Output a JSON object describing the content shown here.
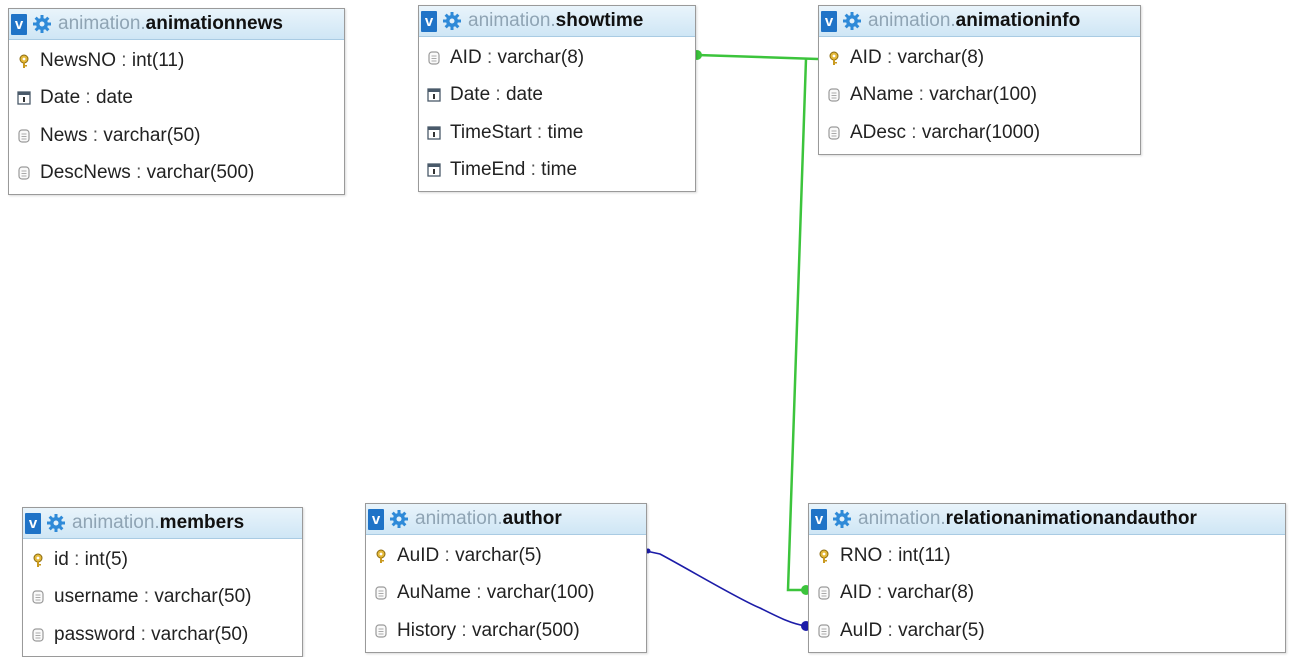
{
  "tables": [
    {
      "db": "animation.",
      "name": "animationnews",
      "columns": [
        {
          "name": "NewsNO",
          "type": "int(11)",
          "icon": "primary-key-icon"
        },
        {
          "name": "Date",
          "type": "date",
          "icon": "date-icon"
        },
        {
          "name": "News",
          "type": "varchar(50)",
          "icon": "text-column-icon"
        },
        {
          "name": "DescNews",
          "type": "varchar(500)",
          "icon": "text-column-icon"
        }
      ]
    },
    {
      "db": "animation.",
      "name": "showtime",
      "columns": [
        {
          "name": "AID",
          "type": "varchar(8)",
          "icon": "text-column-icon"
        },
        {
          "name": "Date",
          "type": "date",
          "icon": "date-icon"
        },
        {
          "name": "TimeStart",
          "type": "time",
          "icon": "date-icon"
        },
        {
          "name": "TimeEnd",
          "type": "time",
          "icon": "date-icon"
        }
      ]
    },
    {
      "db": "animation.",
      "name": "animationinfo",
      "columns": [
        {
          "name": "AID",
          "type": "varchar(8)",
          "icon": "primary-key-icon"
        },
        {
          "name": "AName",
          "type": "varchar(100)",
          "icon": "text-column-icon"
        },
        {
          "name": "ADesc",
          "type": "varchar(1000)",
          "icon": "text-column-icon"
        }
      ]
    },
    {
      "db": "animation.",
      "name": "members",
      "columns": [
        {
          "name": "id",
          "type": "int(5)",
          "icon": "primary-key-icon"
        },
        {
          "name": "username",
          "type": "varchar(50)",
          "icon": "text-column-icon"
        },
        {
          "name": "password",
          "type": "varchar(50)",
          "icon": "text-column-icon"
        }
      ]
    },
    {
      "db": "animation.",
      "name": "author",
      "columns": [
        {
          "name": "AuID",
          "type": "varchar(5)",
          "icon": "primary-key-icon"
        },
        {
          "name": "AuName",
          "type": "varchar(100)",
          "icon": "text-column-icon"
        },
        {
          "name": "History",
          "type": "varchar(500)",
          "icon": "text-column-icon"
        }
      ]
    },
    {
      "db": "animation.",
      "name": "relationanimationandauthor",
      "columns": [
        {
          "name": "RNO",
          "type": "int(11)",
          "icon": "primary-key-icon"
        },
        {
          "name": "AID",
          "type": "varchar(8)",
          "icon": "text-column-icon"
        },
        {
          "name": "AuID",
          "type": "varchar(5)",
          "icon": "text-column-icon"
        }
      ]
    }
  ],
  "ui": {
    "collapse_label": "v",
    "separator": " : "
  },
  "colors": {
    "relation_green": "#3cc43c",
    "relation_blue": "#1c1ca8",
    "toggle_blue": "#1f73c7",
    "gear_blue": "#2f8ad8"
  }
}
